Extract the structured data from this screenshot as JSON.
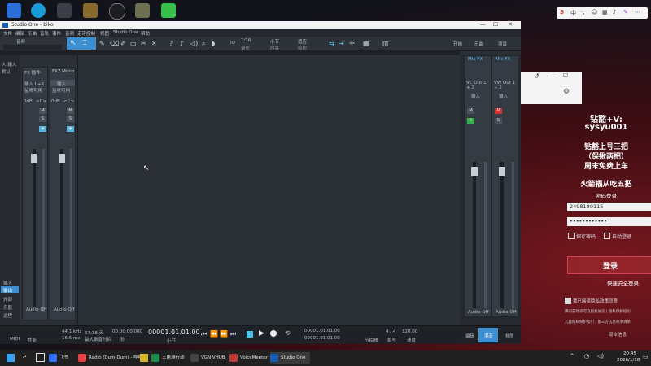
{
  "window": {
    "title": "Studio One - biko",
    "controls": [
      "—",
      "☐",
      "✕"
    ]
  },
  "menu": [
    "文件",
    "编辑",
    "乐曲",
    "音轨",
    "事件",
    "音频",
    "走带控制",
    "视图",
    "Studio One",
    "帮助"
  ],
  "toolbar": {
    "preset_label": "音频",
    "quantize_value": "1/16",
    "quantize_label": "量化",
    "timebase_value": "小节",
    "timebase_label": "时基",
    "snap_value": "适应",
    "snap_label": "吸附",
    "tabs": [
      "开始",
      "乐曲",
      "项目"
    ],
    "iq_label": "IQ"
  },
  "inspector": {
    "row1": "入 输入",
    "row2": "默认"
  },
  "channels": [
    {
      "name": "输入 L+R",
      "badge": "输入",
      "insert": "FX 插件",
      "mono_label": "<C>",
      "sub": "监听可用",
      "db": "0dB",
      "num": "1",
      "footer": "Audio Off",
      "btn": "1"
    },
    {
      "name": "输入",
      "badge": "输入",
      "insert": "FX2 Mono",
      "mono_label": "<C>",
      "sub": "监听可用",
      "db": "0dB",
      "num": "2",
      "footer": "Audio Off",
      "btn": "3"
    }
  ],
  "left_side": [
    "输入",
    "输出",
    "外部",
    "乐器",
    "远程"
  ],
  "bus": [
    {
      "name": "Mix FX",
      "sub": "VC Out 1 + 2",
      "label": "输入",
      "footer": "Audio Off"
    },
    {
      "name": "Mix FX",
      "sub": "VW Out 1 + 2",
      "label": "输入",
      "footer": "Audio Off"
    }
  ],
  "transport": {
    "midi": "MIDI",
    "perf": "性能",
    "sample_rate": "44.1 kHz",
    "latency": "16.5 ms",
    "rec_time": "67:18 天",
    "rec_label": "最大录音时间",
    "timecode": "00:00:00.000",
    "timecode_label": "秒",
    "bars": "00001.01.01.00",
    "bars_label": "小节",
    "loop_l": "00001.01.01.00",
    "loop_r": "00001.01.01.00",
    "metronome": "节拍器",
    "signature": "4 / 4",
    "sig_label": "拍号",
    "tempo": "120.00",
    "tempo_label": "速度",
    "views": [
      "编辑",
      "混音",
      "浏览"
    ]
  },
  "popup": {
    "history_icon": "↺",
    "gear_icon": "⚙"
  },
  "login": {
    "line1": "钻豁+V:",
    "line2": "sysyu001",
    "line3": "钻豁上号三把",
    "line4": "（保揪两把）",
    "line5": "周末免费上车",
    "line6": "火箭福从吃五把",
    "password_login": "密码登录",
    "username": "2498180115",
    "password": "••••••••••••",
    "remember": "保存密码",
    "autologin": "自动登录",
    "login_button": "登录",
    "safe_login": "快速安全登录",
    "agree": "我已阅读隐私政策同意",
    "note1": "腾讯游戏许可及服务协议 | 隐私保护指引",
    "note2": "儿童隐私保护指引 | 第三方信息共享清单",
    "version": "版本信息"
  },
  "ime": [
    "S",
    "中",
    "·,",
    "☺",
    "▦",
    "♪",
    "✎",
    "⋯"
  ],
  "taskbar": {
    "apps": [
      "飞书",
      "Radio (Dum-Dum) - 哔哩",
      "三角洲行动",
      "VGN VHUB",
      "VoiceMeeter",
      "Studio One"
    ],
    "time": "20:45",
    "date": "2026/1/18"
  }
}
